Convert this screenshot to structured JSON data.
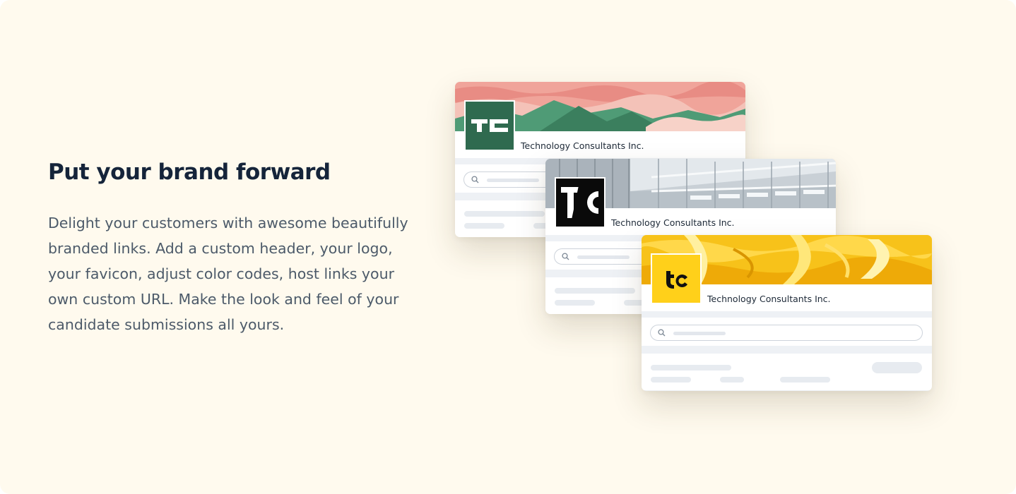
{
  "feature": {
    "heading": "Put your brand forward",
    "description": "Delight your customers with awesome beautifully branded links.  Add a custom header, your logo, your favicon, adjust color codes, host links your own custom URL. Make the look and feel of your candidate submissions all yours."
  },
  "cards": [
    {
      "company": "Technology Consultants Inc.",
      "logo_text": "TC",
      "logo_bg": "#2f6a4f",
      "header_style": "pink-mountains"
    },
    {
      "company": "Technology Consultants Inc.",
      "logo_text": "TC",
      "logo_bg": "#0a0a0a",
      "header_style": "glass-building"
    },
    {
      "company": "Technology Consultants Inc.",
      "logo_text": "tc",
      "logo_bg": "#ffd01a",
      "header_style": "yellow-marble"
    }
  ],
  "colors": {
    "panel_bg": "#fffaee",
    "heading": "#15243a",
    "body_text": "#4c5a69"
  }
}
